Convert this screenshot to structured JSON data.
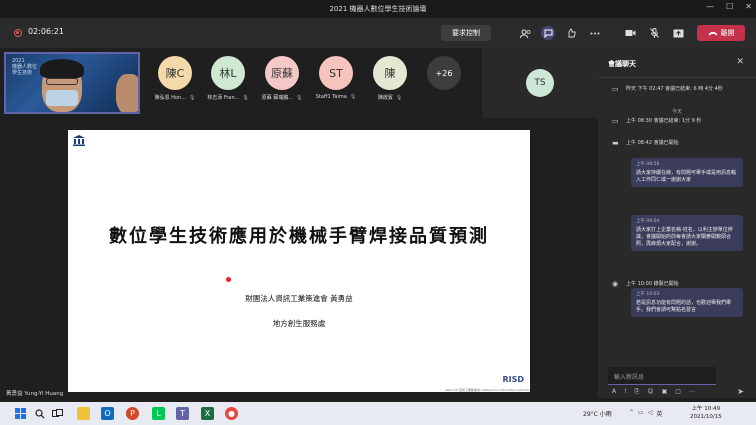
{
  "window": {
    "title": "2021 機器人數位學生技術論壇",
    "controls": [
      "—",
      "☐",
      "✕"
    ]
  },
  "toolbar": {
    "timer": "02:06:21",
    "request_control": "要求控制",
    "leave_label": "離開"
  },
  "self_video": {
    "banner_line1": "2021",
    "banner_line2": "機器人數位",
    "banner_line3": "學生技術"
  },
  "participants": [
    {
      "initials": "陳C",
      "name": "陳弘恩 Hon...",
      "color": "#f4d9a9"
    },
    {
      "initials": "林L",
      "name": "林志添 Fran...",
      "color": "#cfe8d2"
    },
    {
      "initials": "原蘇",
      "name": "原蘇 蘇瑞鵬...",
      "color": "#f5c8c8"
    },
    {
      "initials": "ST",
      "name": "Staff1 Taima",
      "color": "#f7c3bd"
    },
    {
      "initials": "陳",
      "name": "陳啟賓",
      "color": "#e4e8d2"
    }
  ],
  "more_participants": "+26",
  "ts_tile": {
    "initials": "TS"
  },
  "slide": {
    "title": "數位學生技術應用於機械手臂焊接品質預測",
    "org": "財團法人資訊工業策進會 黃勇益",
    "dept": "地方創生服務處",
    "brand": "RISD",
    "footer": "2021 XX 資訊工業策進會 Institute for Information Industry"
  },
  "speaker_name": "黃勇益 Yung-Yi Huang",
  "chat": {
    "title": "會議聊天",
    "sys1": "昨天 下午 02:47 會議已結束: 6 時 4分 4秒",
    "day_sep": "今天",
    "sys2": "上午 08:30 會議已結束: 1分 9 秒",
    "sys3": "上午 08:42 會議已開始",
    "sys4": "上午 10:00 錄製已開始",
    "messages": [
      {
        "time": "上午 08:56",
        "text": "請大家持續在線，有問題可舉手或是用訊息輸入工作同仁或一謝謝大家"
      },
      {
        "time": "上午 09:04",
        "text": "請大家打上企業名稱-姓名，以利主辦單位辨識，會議開始的前每會請大家關麥開鏡頭合照，再麻煩大家配合，謝謝。"
      },
      {
        "time": "上午 10:03",
        "text": "若是訊息功能有問題的話，也歡迎舉我們舉手，我們會請可幫點名發言"
      }
    ],
    "input_placeholder": "輸入新訊息"
  },
  "taskbar": {
    "weather": "29°C 小雨",
    "time": "上午 10:49",
    "date": "2021/10/15"
  }
}
